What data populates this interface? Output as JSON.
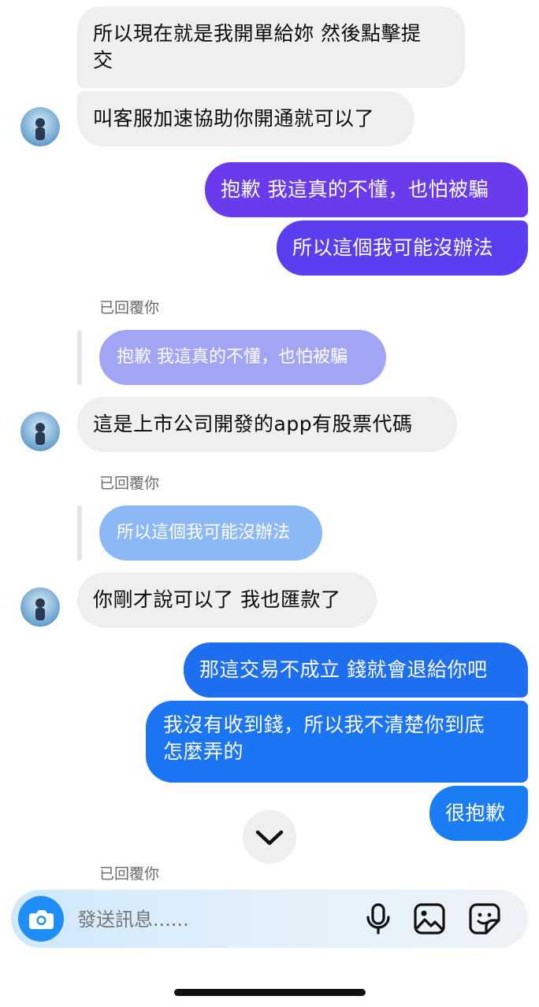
{
  "messages": {
    "m1": "所以現在就是我開單給妳 然後點擊提",
    "m1b": "交",
    "m2": "叫客服加速協助你開通就可以了",
    "m3": "抱歉 我這真的不懂，也怕被騙",
    "m4": "所以這個我可能沒辦法",
    "reply_label": "已回覆你",
    "q1": "抱歉 我這真的不懂，也怕被騙",
    "m5": "這是上市公司開發的app有股票代碼",
    "q2": "所以這個我可能沒辦法",
    "m6": "你剛才說可以了 我也匯款了",
    "m7": "那這交易不成立 錢就會退給你吧",
    "m8a": "我沒有收到錢，所以我不清楚你到底",
    "m8b": "怎麼弄的",
    "m9": "很抱歉"
  },
  "composer": {
    "placeholder": "發送訊息......"
  },
  "icons": {
    "camera": "camera-icon",
    "mic": "microphone-icon",
    "gallery": "image-icon",
    "sticker": "sticker-icon",
    "scroll": "chevron-down-icon"
  },
  "colors": {
    "incoming": "#efeff1",
    "purple": "#6f3ef0",
    "blue": "#1a74f2",
    "quote_purple": "#9fa4f3",
    "quote_blue": "#8bb7f6"
  }
}
